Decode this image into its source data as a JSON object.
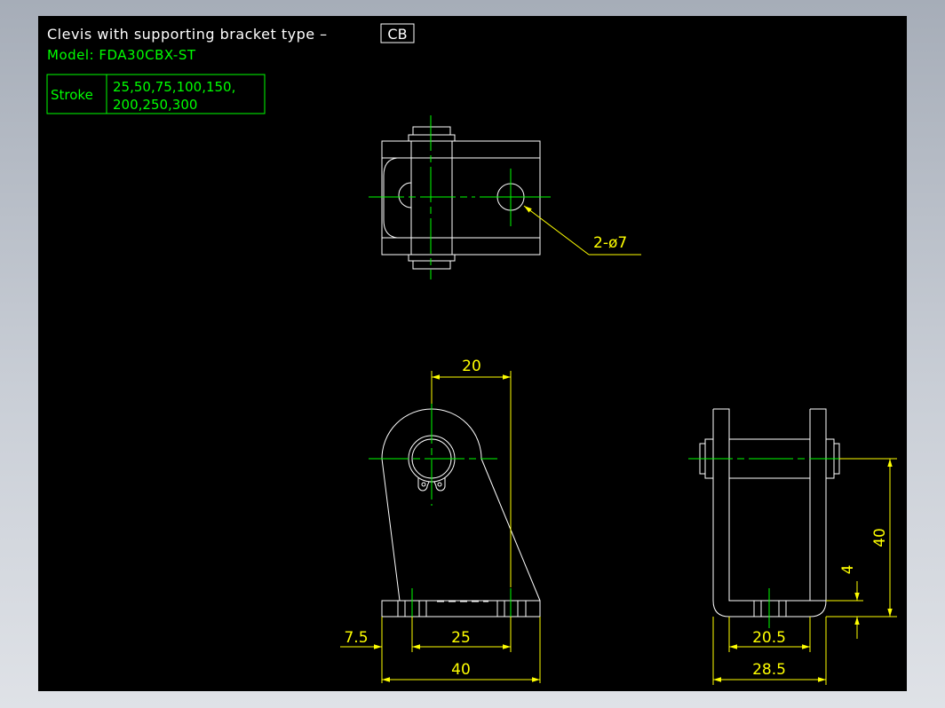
{
  "title": {
    "prefix": "Clevis with supporting bracket type –",
    "type_code": "CB",
    "model": "Model: FDA30CBX-ST"
  },
  "stroke_table": {
    "label": "Stroke",
    "values_line1": "25,50,75,100,150,",
    "values_line2": "200,250,300"
  },
  "dimensions": {
    "hole_callout": "2-ø7",
    "pin_offset": "20",
    "edge_offset": "7.5",
    "hole_spacing": "25",
    "base_length": "40",
    "pin_height": "40",
    "base_thickness": "4",
    "inner_width": "20.5",
    "outer_width": "28.5"
  },
  "colors": {
    "background": "#000000",
    "geometry": "#ffffff",
    "centerline": "#00ff00",
    "dimension": "#ffff00",
    "title_text": "#ffffff",
    "model_text": "#00ff00"
  }
}
